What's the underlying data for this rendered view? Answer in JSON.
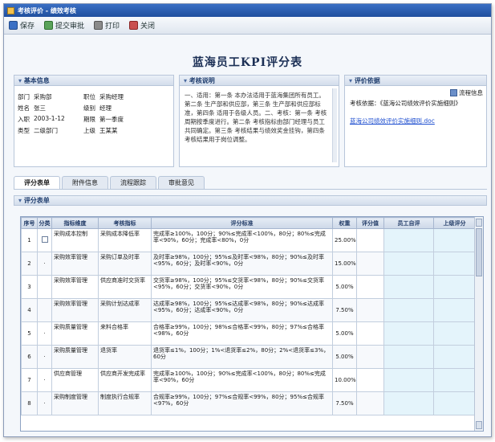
{
  "window": {
    "title": "考核评价 - 绩效考核"
  },
  "toolbar": {
    "save": "保存",
    "submit": "提交审批",
    "print": "打印",
    "close": "关闭"
  },
  "page": {
    "title": "蓝海员工KPI评分表"
  },
  "basic_info": {
    "header": "基本信息",
    "rows": [
      [
        "部门",
        "采购部",
        "职位",
        "采购经理"
      ],
      [
        "姓名",
        "张三",
        "级别",
        "经理"
      ],
      [
        "入职",
        "2003-1-12",
        "期限",
        "第一季度"
      ],
      [
        "类型",
        "二级部门",
        "上级",
        "王某某"
      ]
    ]
  },
  "intro": {
    "header": "考核说明",
    "text": "一、适用：第一条 本办法适用于蓝海集团所有员工。第二条 生产部和供应部，第三条 生产部和供应部标准，第四条 适用于各级人员。二、考核：第一条 考核周期按季度进行。第二条 考核指标由部门经理与员工共同确定。第三条 考核结果与绩效奖金挂钩，第四条 考核结果用于岗位调整。"
  },
  "eval": {
    "header": "评价依据",
    "flow_button": "流程信息",
    "doc_label": "考核依据：",
    "doc_name": "《蓝海公司绩效评价实施细则》",
    "link_text": "蓝海公司绩效评价实施细则.doc"
  },
  "tabs": [
    "评分表单",
    "附件信息",
    "流程跟踪",
    "审批意见"
  ],
  "section": {
    "header": "评分表单"
  },
  "table": {
    "headers": [
      "序号",
      "分类",
      "指标维度",
      "考核指标",
      "评分标准",
      "权重",
      "评分值",
      "员工自评",
      "上级评分"
    ],
    "rows": [
      [
        "1",
        "",
        "采购成本控制",
        "采购成本降低率",
        "完成率≥100%，100分；90%≤完成率<100%，80分；80%≤完成率<90%，60分；完成率<80%，0分",
        "25.00%",
        "",
        "",
        ""
      ],
      [
        "2",
        "·",
        "采购效率管理",
        "采购订单及时率",
        "及时率≥98%，100分；95%≤及时率<98%，80分；90%≤及时率<95%，60分；及时率<90%，0分",
        "15.00%",
        "",
        "",
        ""
      ],
      [
        "3",
        "",
        "采购效率管理",
        "供应商准时交货率",
        "交货率≥98%，100分；95%≤交货率<98%，80分；90%≤交货率<95%，60分；交货率<90%，0分",
        "5.00%",
        "",
        "",
        ""
      ],
      [
        "4",
        "",
        "采购效率管理",
        "采购计划达成率",
        "达成率≥98%，100分；95%≤达成率<98%，80分；90%≤达成率<95%，60分；达成率<90%，0分",
        "7.50%",
        "",
        "",
        ""
      ],
      [
        "5",
        "·",
        "采购质量管理",
        "来料合格率",
        "合格率≥99%，100分；98%≤合格率<99%，80分；97%≤合格率<98%，60分",
        "5.00%",
        "",
        "",
        ""
      ],
      [
        "6",
        "·",
        "采购质量管理",
        "退货率",
        "退货率≤1%，100分；1%<退货率≤2%，80分；2%<退货率≤3%，60分",
        "5.00%",
        "",
        "",
        ""
      ],
      [
        "7",
        "·",
        "供应商管理",
        "供应商开发完成率",
        "完成率≥100%，100分；90%≤完成率<100%，80分；80%≤完成率<90%，60分",
        "10.00%",
        "",
        "",
        ""
      ],
      [
        "8",
        "·",
        "采购制度管理",
        "制度执行合规率",
        "合规率≥99%，100分；97%≤合规率<99%，80分；95%≤合规率<97%，60分",
        "7.50%",
        "",
        "",
        ""
      ]
    ]
  }
}
